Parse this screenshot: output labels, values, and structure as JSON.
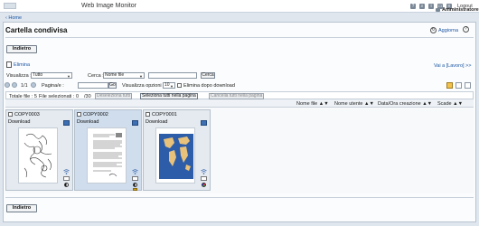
{
  "header": {
    "app_title": "Web Image Monitor",
    "logout": "Logout",
    "user": "Amministratore",
    "icons": [
      "help-icon",
      "search-icon",
      "info-icon",
      "printer-icon",
      "list-icon"
    ]
  },
  "breadcrumb": {
    "home": "Home"
  },
  "page": {
    "title": "Cartella condivisa",
    "refresh": "Aggiorna",
    "back": "Indietro",
    "delete": "Elimina",
    "goto_job": "Vai a [Lavoro] >>"
  },
  "filters": {
    "view_label": "Visualizza :",
    "view_value": "Tutto",
    "search_label": "Cerca :",
    "search_field": "Nome file",
    "search_button": "Cerca",
    "page_current": "1/1",
    "page_label": "Pagina/e :",
    "go_button": "Go",
    "view_options_label": "Visualizza opzioni :",
    "view_options_value": "10",
    "delete_after_download": "Elimina dopo download"
  },
  "summary": {
    "total_files": "Totale file : 5",
    "selected_files": "File selezionati : 0",
    "max": "/30",
    "deselect_all": "Deseleziona tutti",
    "select_all_page": "Seleziona tutti nella pagina",
    "cancel_all_page": "Cancella tutti nella pagina"
  },
  "sort": {
    "file_name": "Nome file ▲▼",
    "user_name": "Nome utente ▲▼",
    "date": "Data/Ora creazione ▲▼",
    "expiry": "Scade ▲▼"
  },
  "documents": [
    {
      "name": "COPY0003",
      "action": "Download"
    },
    {
      "name": "COPY0002",
      "action": "Download"
    },
    {
      "name": "COPY0001",
      "action": "Download"
    }
  ],
  "colors": {
    "link": "#1b56a5",
    "selected_card": "#cfdded",
    "card": "#e4eaf0",
    "map_bg": "#2d5da8",
    "map_land": "#e8c27a"
  }
}
